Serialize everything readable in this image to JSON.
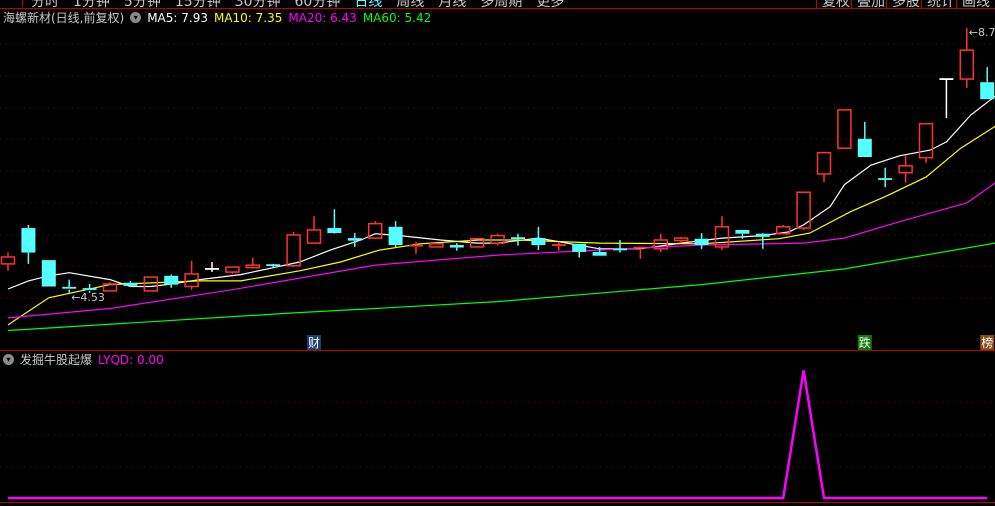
{
  "toolbar": {
    "periods": [
      "分时",
      "1分钟",
      "5分钟",
      "15分钟",
      "30分钟",
      "60分钟",
      "日线",
      "周线",
      "月线",
      "多周期",
      "更多"
    ],
    "active_period": "日线",
    "buttons": [
      "复权",
      "叠加",
      "多股",
      "统计",
      "画线"
    ]
  },
  "header": {
    "title": "海螺新材(日线,前复权)",
    "ma": [
      {
        "label": "MA5: 7.93",
        "color": "#ffffff"
      },
      {
        "label": "MA10: 7.35",
        "color": "#ffff00"
      },
      {
        "label": "MA20: 6.43",
        "color": "#ff00ff"
      },
      {
        "label": "MA60: 5.42",
        "color": "#00ff00"
      }
    ]
  },
  "indicator": {
    "name": "发掘牛股起爆",
    "value_label": "LYQD: 0.00",
    "color": "#ff00ff"
  },
  "colors": {
    "up": "#ff3232",
    "down": "#54ffff",
    "flat": "#ffffff",
    "grid": "#8b0000",
    "border": "#c00000"
  },
  "chart_data": [
    {
      "type": "candlestick",
      "ylim": [
        3.62,
        8.87
      ],
      "grid": true,
      "low_annotation": {
        "index": 3,
        "label": "4.53"
      },
      "high_annotation": {
        "index": 47,
        "label": "8.7"
      },
      "candles_ohlc": [
        [
          4.99,
          5.17,
          4.88,
          5.1
        ],
        [
          5.56,
          5.61,
          4.99,
          5.17
        ],
        [
          5.05,
          5.05,
          4.63,
          4.63
        ],
        [
          4.61,
          4.74,
          4.53,
          4.58
        ],
        [
          4.59,
          4.67,
          4.53,
          4.56
        ],
        [
          4.56,
          4.7,
          4.56,
          4.67
        ],
        [
          4.69,
          4.72,
          4.63,
          4.64
        ],
        [
          4.56,
          4.78,
          4.56,
          4.78
        ],
        [
          4.8,
          4.82,
          4.61,
          4.66
        ],
        [
          4.63,
          5.04,
          4.58,
          4.83
        ],
        [
          4.91,
          5.02,
          4.86,
          4.91
        ],
        [
          4.86,
          4.94,
          4.83,
          4.94
        ],
        [
          4.93,
          5.09,
          4.93,
          4.97
        ],
        [
          4.97,
          4.99,
          4.93,
          4.96
        ],
        [
          4.96,
          5.5,
          4.94,
          5.45
        ],
        [
          5.32,
          5.75,
          5.32,
          5.53
        ],
        [
          5.56,
          5.86,
          5.47,
          5.48
        ],
        [
          5.4,
          5.48,
          5.26,
          5.36
        ],
        [
          5.4,
          5.67,
          5.4,
          5.63
        ],
        [
          5.58,
          5.67,
          5.26,
          5.29
        ],
        [
          5.26,
          5.34,
          5.15,
          5.28
        ],
        [
          5.26,
          5.32,
          5.26,
          5.31
        ],
        [
          5.29,
          5.32,
          5.2,
          5.25
        ],
        [
          5.26,
          5.39,
          5.26,
          5.39
        ],
        [
          5.32,
          5.47,
          5.28,
          5.44
        ],
        [
          5.4,
          5.47,
          5.28,
          5.39
        ],
        [
          5.4,
          5.58,
          5.21,
          5.29
        ],
        [
          5.28,
          5.34,
          5.2,
          5.29
        ],
        [
          5.31,
          5.31,
          5.09,
          5.18
        ],
        [
          5.18,
          5.26,
          5.12,
          5.12
        ],
        [
          5.22,
          5.37,
          5.17,
          5.21
        ],
        [
          5.23,
          5.25,
          5.07,
          5.25
        ],
        [
          5.23,
          5.47,
          5.18,
          5.37
        ],
        [
          5.36,
          5.42,
          5.34,
          5.4
        ],
        [
          5.39,
          5.48,
          5.23,
          5.29
        ],
        [
          5.26,
          5.75,
          5.21,
          5.58
        ],
        [
          5.53,
          5.53,
          5.39,
          5.47
        ],
        [
          5.47,
          5.48,
          5.23,
          5.42
        ],
        [
          5.47,
          5.61,
          5.47,
          5.58
        ],
        [
          5.56,
          6.13,
          5.53,
          6.13
        ],
        [
          6.42,
          6.76,
          6.29,
          6.76
        ],
        [
          6.83,
          7.44,
          6.83,
          7.44
        ],
        [
          6.98,
          7.25,
          6.69,
          6.69
        ],
        [
          6.34,
          6.52,
          6.21,
          6.33
        ],
        [
          6.44,
          6.72,
          6.28,
          6.55
        ],
        [
          6.68,
          7.22,
          6.6,
          7.22
        ],
        [
          7.93,
          7.93,
          7.31,
          7.93
        ],
        [
          7.93,
          8.74,
          7.79,
          8.39
        ],
        [
          7.88,
          8.12,
          7.61,
          7.61
        ]
      ],
      "flat_candle_indices": [
        10,
        46
      ],
      "ma_lines": [
        {
          "name": "MA5",
          "color": "#ffffff",
          "points": [
            [
              0,
              4.59
            ],
            [
              1,
              4.72
            ],
            [
              2,
              4.8
            ],
            [
              3,
              4.85
            ],
            [
              5,
              4.74
            ],
            [
              6,
              4.63
            ],
            [
              7,
              4.63
            ],
            [
              8,
              4.67
            ],
            [
              9.4,
              4.74
            ],
            [
              11.4,
              4.82
            ],
            [
              13,
              4.93
            ],
            [
              14.3,
              5.02
            ],
            [
              15.8,
              5.21
            ],
            [
              17.3,
              5.37
            ],
            [
              18,
              5.47
            ],
            [
              19.2,
              5.44
            ],
            [
              21.2,
              5.37
            ],
            [
              23,
              5.32
            ],
            [
              24,
              5.32
            ],
            [
              26,
              5.4
            ],
            [
              29,
              5.23
            ],
            [
              31,
              5.23
            ],
            [
              33,
              5.32
            ],
            [
              35,
              5.4
            ],
            [
              37,
              5.44
            ],
            [
              38.3,
              5.5
            ],
            [
              39,
              5.61
            ],
            [
              40.3,
              5.9
            ],
            [
              41,
              6.25
            ],
            [
              42.3,
              6.56
            ],
            [
              43.7,
              6.71
            ],
            [
              45.2,
              6.8
            ],
            [
              46,
              6.93
            ],
            [
              47.2,
              7.36
            ],
            [
              48.4,
              7.66
            ]
          ]
        },
        {
          "name": "MA10",
          "color": "#ffff00",
          "points": [
            [
              0,
              4.02
            ],
            [
              2,
              4.45
            ],
            [
              5,
              4.66
            ],
            [
              9.4,
              4.72
            ],
            [
              11.4,
              4.72
            ],
            [
              14.3,
              4.88
            ],
            [
              16.3,
              5.02
            ],
            [
              18.2,
              5.21
            ],
            [
              20.2,
              5.31
            ],
            [
              23.1,
              5.37
            ],
            [
              25,
              5.37
            ],
            [
              29,
              5.32
            ],
            [
              34,
              5.31
            ],
            [
              37.8,
              5.39
            ],
            [
              39.3,
              5.48
            ],
            [
              41.3,
              5.82
            ],
            [
              43,
              6.06
            ],
            [
              45,
              6.37
            ],
            [
              46.7,
              6.83
            ],
            [
              48.4,
              7.18
            ]
          ]
        },
        {
          "name": "MA20",
          "color": "#ff00ff",
          "points": [
            [
              0,
              4.13
            ],
            [
              5,
              4.28
            ],
            [
              11,
              4.58
            ],
            [
              18,
              4.97
            ],
            [
              24,
              5.13
            ],
            [
              34,
              5.29
            ],
            [
              39,
              5.32
            ],
            [
              41,
              5.4
            ],
            [
              44,
              5.69
            ],
            [
              47,
              5.96
            ],
            [
              48.4,
              6.28
            ]
          ]
        },
        {
          "name": "MA60",
          "color": "#00ff00",
          "points": [
            [
              0,
              3.93
            ],
            [
              14,
              4.21
            ],
            [
              18,
              4.28
            ],
            [
              24,
              4.39
            ],
            [
              34,
              4.66
            ],
            [
              41,
              4.91
            ],
            [
              48.4,
              5.32
            ]
          ]
        }
      ],
      "event_markers": [
        {
          "index": 15,
          "label": "财",
          "bg": "#1b3f6e"
        },
        {
          "index": 42,
          "label": "跌",
          "bg": "#0a7a0a"
        },
        {
          "index": 48,
          "label": "榜",
          "bg": "#8a4a10"
        }
      ]
    },
    {
      "type": "line",
      "name": "LYQD",
      "ylim": [
        0,
        1.16
      ],
      "grid": true,
      "values": [
        0,
        0,
        0,
        0,
        0,
        0,
        0,
        0,
        0,
        0,
        0,
        0,
        0,
        0,
        0,
        0,
        0,
        0,
        0,
        0,
        0,
        0,
        0,
        0,
        0,
        0,
        0,
        0,
        0,
        0,
        0,
        0,
        0,
        0,
        0,
        0,
        0,
        0,
        0,
        1,
        0,
        0,
        0,
        0,
        0,
        0,
        0,
        0,
        0
      ]
    }
  ]
}
